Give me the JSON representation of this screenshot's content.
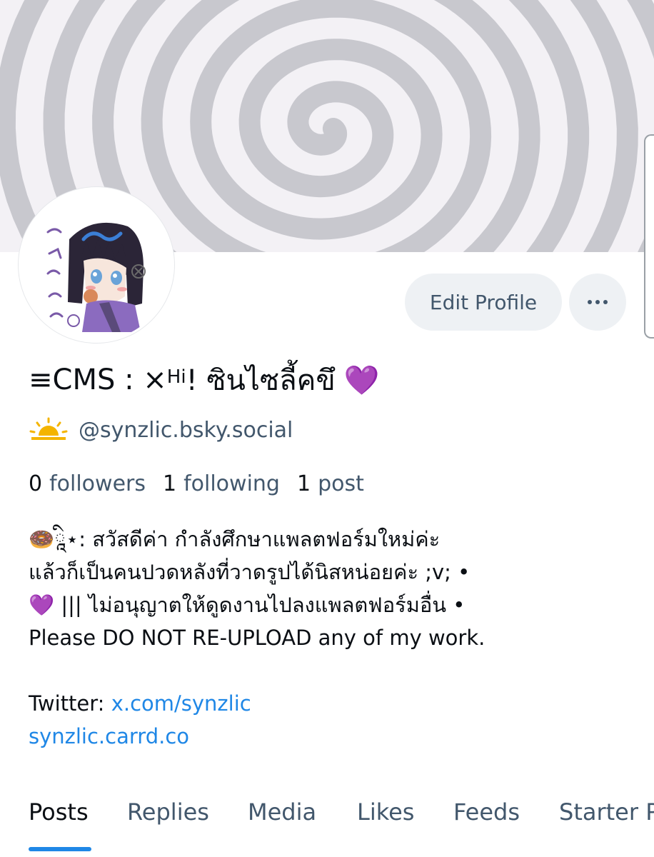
{
  "profile": {
    "display_name_main": "≡CMS : ×",
    "display_name_sup": "Hi",
    "display_name_rest": " ! ซินไซลี้คขึ",
    "display_name_emoji": "💜",
    "handle": "@synzlic.bsky.social",
    "handle_icon": "sun-icon"
  },
  "actions": {
    "edit_profile_label": "Edit Profile",
    "more_icon": "ellipsis-icon"
  },
  "stats": {
    "followers_count": "0",
    "followers_label": "followers",
    "following_count": "1",
    "following_label": "following",
    "posts_count": "1",
    "posts_label": "post"
  },
  "bio": {
    "line1": "🍩ཱི⋆: สวัสดีค่า กำลังศึกษาแพลตฟอร์มใหม่ค่ะ",
    "line2": "แล้วก็เป็นคนปวดหลังที่วาดรูปได้นิสหน่อยค่ะ ;v; •",
    "line3": "💜 ||| ไม่อนุญาตให้ดูดงานไปลงแพลตฟอร์มอื่น •",
    "line4": "Please DO NOT RE-UPLOAD any of my work.",
    "twitter_label": "Twitter: ",
    "twitter_link": "x.com/synzlic",
    "carrd_link": "synzlic.carrd.co"
  },
  "tabs": [
    "Posts",
    "Replies",
    "Media",
    "Likes",
    "Feeds",
    "Starter Packs"
  ],
  "active_tab": "Posts",
  "colors": {
    "link": "#1f87e6",
    "secondary_text": "#42576c",
    "button_bg": "#eef1f4",
    "spiral": "#c9c9cf"
  }
}
